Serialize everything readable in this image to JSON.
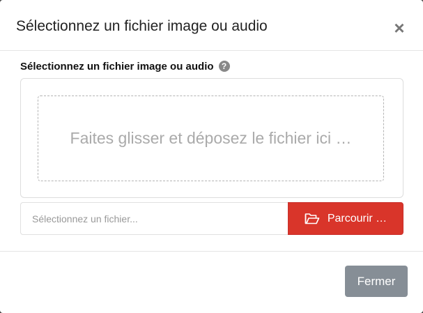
{
  "dialog": {
    "title": "Sélectionnez un fichier image ou audio",
    "close_symbol": "×"
  },
  "body": {
    "label": "Sélectionnez un fichier image ou audio",
    "help_symbol": "?",
    "drop_zone_text": "Faites glisser et déposez le fichier ici …",
    "file_placeholder": "Sélectionnez un fichier...",
    "browse_label": "Parcourir …",
    "browse_icon": "folder-open-icon"
  },
  "footer": {
    "close_label": "Fermer"
  },
  "colors": {
    "browse_button": "#d9352a",
    "close_button": "#868e96"
  }
}
